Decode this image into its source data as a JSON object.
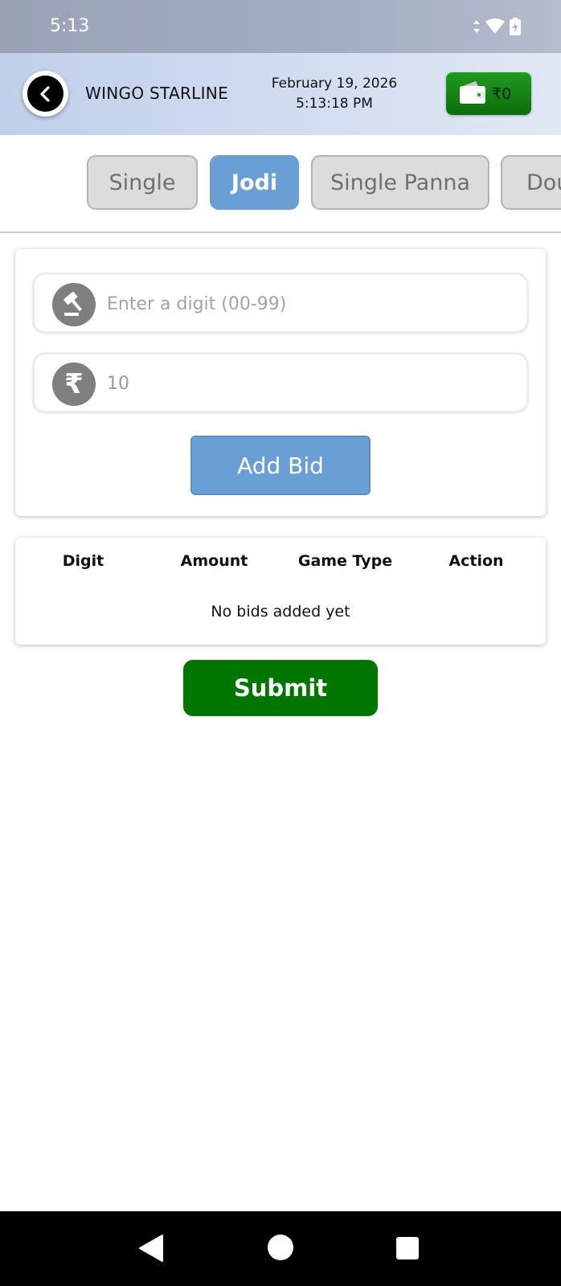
{
  "status_bar": {
    "time": "5:13"
  },
  "header": {
    "title": "WINGO STARLINE",
    "date": "February 19, 2026",
    "time": "5:13:18 PM",
    "wallet_amount": "₹0"
  },
  "tabs": [
    {
      "label": "Single",
      "active": false
    },
    {
      "label": "Jodi",
      "active": true
    },
    {
      "label": "Single Panna",
      "active": false
    },
    {
      "label": "Double Panna",
      "active": false
    }
  ],
  "bid_form": {
    "digit_placeholder": "Enter a digit (00-99)",
    "digit_value": "",
    "amount_value": "10",
    "add_bid_label": "Add Bid"
  },
  "bids_table": {
    "columns": [
      "Digit",
      "Amount",
      "Game Type",
      "Action"
    ],
    "empty_message": "No bids added yet",
    "rows": []
  },
  "submit_label": "Submit",
  "colors": {
    "active_tab": "#6a9fd5",
    "submit": "#007500",
    "wallet": "#1f9a1f"
  },
  "icons": [
    "wifi-icon",
    "battery-icon",
    "back-arrow-icon",
    "wallet-icon",
    "gavel-icon",
    "rupee-icon",
    "nav-back-icon",
    "nav-home-icon",
    "nav-recents-icon"
  ]
}
